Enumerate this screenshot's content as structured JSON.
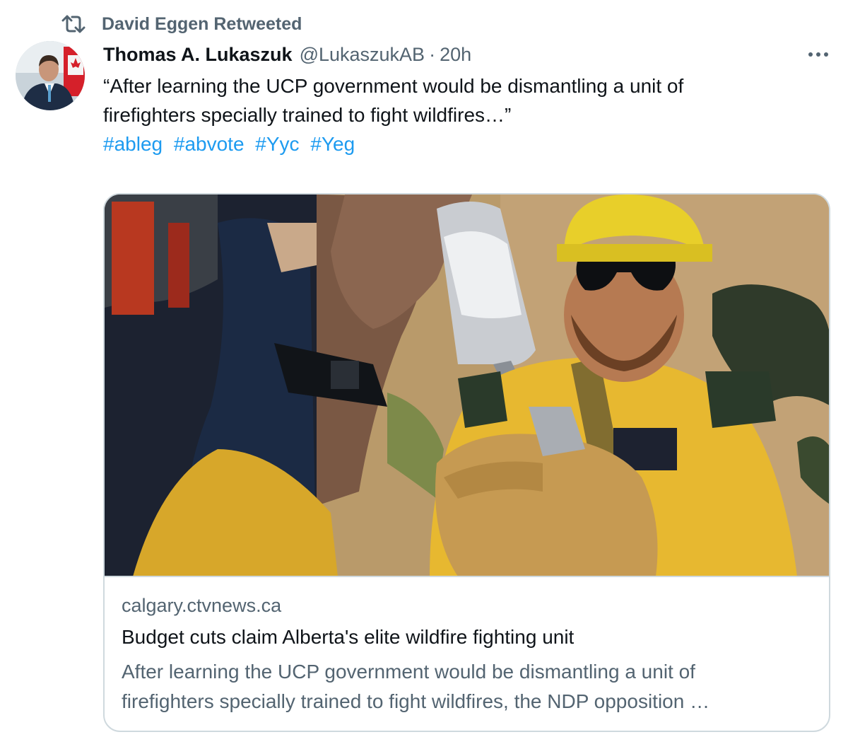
{
  "retweet": {
    "icon": "retweet-icon",
    "label": "David Eggen Retweeted"
  },
  "author": {
    "name": "Thomas A. Lukaszuk",
    "handle": "@LukaszukAB",
    "separator": "·",
    "time": "20h"
  },
  "tweet": {
    "text_lines": [
      "“After learning the UCP government would be dismantling a unit of",
      "firefighters specially trained to fight wildfires…”"
    ],
    "hashtags": [
      "#ableg",
      "#abvote",
      "#Yyc",
      "#Yeg"
    ]
  },
  "card": {
    "domain": "calgary.ctvnews.ca",
    "title": "Budget cuts claim Alberta's elite wildfire fighting unit",
    "description_lines": [
      "After learning the UCP government would be dismantling a unit of",
      "firefighters specially trained to fight wildfires, the NDP opposition …"
    ]
  },
  "colors": {
    "text_primary": "#0f1419",
    "text_secondary": "#536471",
    "link": "#1d9bf0",
    "border": "#cfd9de",
    "helmet_yellow": "#e8cf2a",
    "uniform_yellow": "#e7b830"
  }
}
